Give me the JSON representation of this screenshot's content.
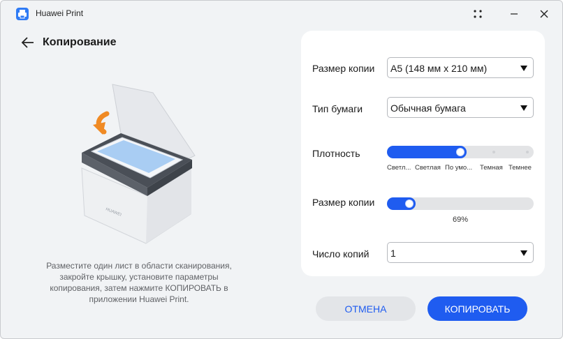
{
  "window": {
    "title": "Huawei Print"
  },
  "page": {
    "title": "Копирование"
  },
  "instructions": "Разместите один лист в области сканирования, закройте крышку, установите параметры копирования, затем нажмите КОПИРОВАТЬ в приложении Huawei Print.",
  "settings": {
    "copy_size": {
      "label": "Размер копии",
      "value": "A5 (148 мм x 210 мм)"
    },
    "paper_type": {
      "label": "Тип бумаги",
      "value": "Обычная бумага"
    },
    "density": {
      "label": "Плотность",
      "levels": [
        "Светл...",
        "Светлая",
        "По умо...",
        "Темная",
        "Темнее"
      ],
      "selected_index": 2
    },
    "scale": {
      "label": "Размер копии",
      "value_percent": 69,
      "value_text": "69%"
    },
    "copies": {
      "label": "Число копий",
      "value": "1"
    }
  },
  "buttons": {
    "cancel": "ОТМЕНА",
    "copy": "КОПИРОВАТЬ"
  },
  "colors": {
    "accent": "#1f5cf0",
    "background": "#f1f3f5",
    "card": "#ffffff",
    "arrow": "#f08a24"
  },
  "icons": [
    "printer-app-icon",
    "more-dots-icon",
    "minimize-icon",
    "close-icon",
    "back-arrow-icon",
    "dropdown-caret-icon"
  ]
}
